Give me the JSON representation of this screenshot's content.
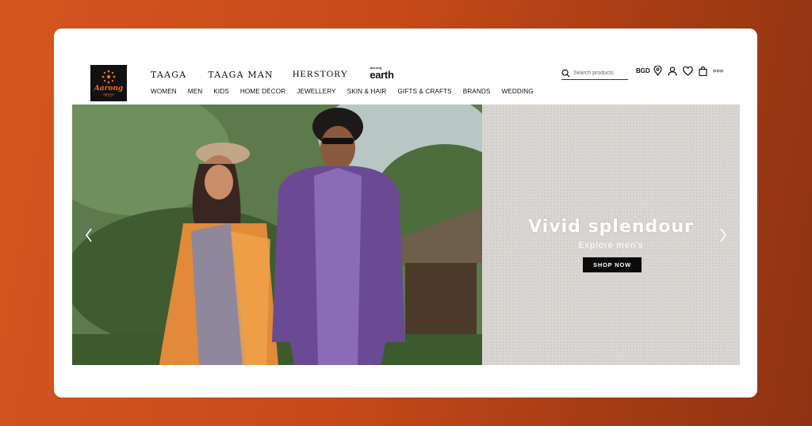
{
  "logo": {
    "word": "Aarong",
    "sub": "আড়ং"
  },
  "brands": [
    "TAAGA",
    "TAAGA MAN",
    "HERSTORY"
  ],
  "earth": {
    "small": "Aarong",
    "big": "earth"
  },
  "categories": [
    "WOMEN",
    "MEN",
    "KIDS",
    "HOME DÉCOR",
    "JEWELLERY",
    "SKIN & HAIR",
    "GIFTS & CRAFTS",
    "BRANDS",
    "WEDDING"
  ],
  "search": {
    "placeholder": "Search products",
    "value": ""
  },
  "region": "BGD",
  "icons": [
    "search-icon",
    "location-pin-icon",
    "user-icon",
    "heart-icon",
    "bag-icon",
    "more-icon",
    "chevron-left-icon",
    "chevron-right-icon"
  ],
  "hero": {
    "headline": "Vivid splendour",
    "subline": "Explore men's",
    "cta": "SHOP NOW"
  },
  "colors": {
    "background": "#c64a1a",
    "logo_bg": "#111111",
    "logo_accent": "#e8731f",
    "panel": "#d7d3cf",
    "cta_bg": "#0b0b0b"
  }
}
